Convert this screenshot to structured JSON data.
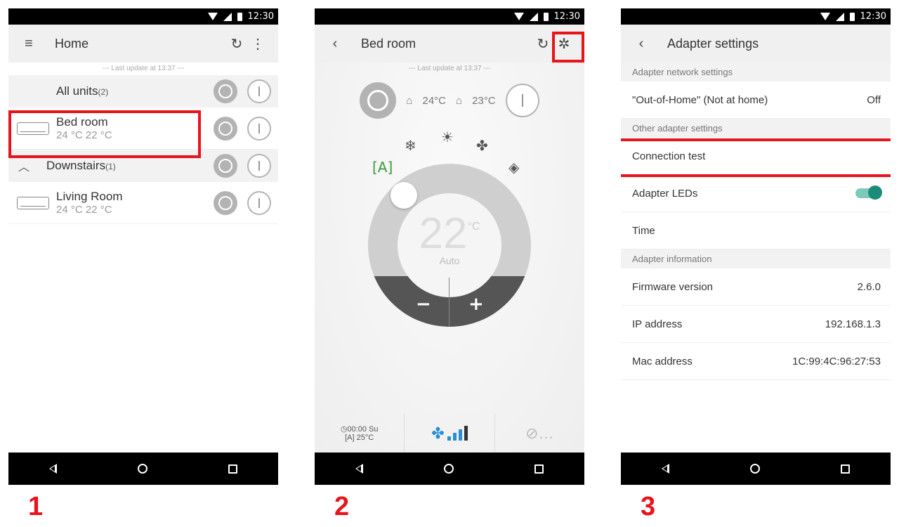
{
  "status_time": "12:30",
  "steps": [
    "1",
    "2",
    "3"
  ],
  "screen1": {
    "title": "Home",
    "last_update": "--- Last update at 13:37 ---",
    "groups": [
      {
        "name": "All units",
        "count": "(2)"
      },
      {
        "name": "Downstairs",
        "count": "(1)"
      }
    ],
    "units": [
      {
        "name": "Bed room",
        "temps": "24 °C  22 °C"
      },
      {
        "name": "Living Room",
        "temps": "24 °C  22 °C"
      }
    ]
  },
  "screen2": {
    "title": "Bed room",
    "last_update": "--- Last update at 13:37 ---",
    "indoor_temp": "24°C",
    "outdoor_temp": "23°C",
    "set_temp": "22",
    "set_unit": "°C",
    "mode": "Auto",
    "minus": "−",
    "plus": "+",
    "timer": "00:00 Su",
    "timer_temp": "25°C",
    "fan_level": 3
  },
  "screen3": {
    "title": "Adapter settings",
    "sections": {
      "network": "Adapter network settings",
      "other": "Other adapter settings",
      "info": "Adapter information"
    },
    "out_of_home": {
      "label": "\"Out-of-Home\" (Not at home)",
      "value": "Off"
    },
    "connection_test": "Connection test",
    "adapter_leds": {
      "label": "Adapter LEDs",
      "on": true
    },
    "time": "Time",
    "firmware": {
      "label": "Firmware version",
      "value": "2.6.0"
    },
    "ip": {
      "label": "IP address",
      "value": "192.168.1.3"
    },
    "mac": {
      "label": "Mac address",
      "value": "1C:99:4C:96:27:53"
    }
  },
  "colors": {
    "highlight": "#e8141c",
    "toggle": "#1b8c78"
  }
}
